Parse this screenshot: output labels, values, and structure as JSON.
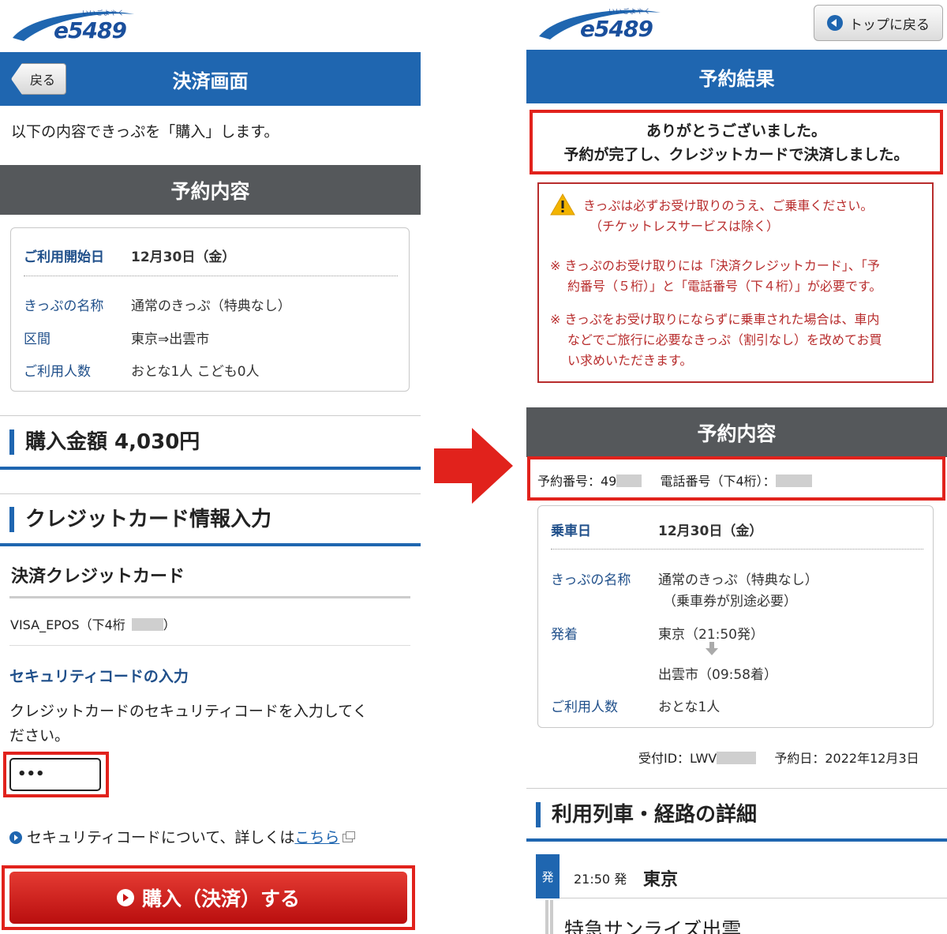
{
  "colors": {
    "primary": "#1f66b0",
    "section_gray": "#55585b",
    "accent_red": "#e1221c",
    "warning_red": "#b82d2d"
  },
  "logo": {
    "text": "e5489",
    "ruby": "いいごよやく"
  },
  "left": {
    "back_label": "戻る",
    "title": "決済画面",
    "intro": "以下の内容できっぷを「購入」します。",
    "summary_header": "予約内容",
    "summary": {
      "start_label": "ご利用開始日",
      "start_value": "12月30日（金）",
      "name_label": "きっぷの名称",
      "name_value": "通常のきっぷ（特典なし）",
      "section_label": "区間",
      "section_value": "東京⇒出雲市",
      "people_label": "ご利用人数",
      "people_value": "おとな1人 こども0人"
    },
    "price_heading": "購入金額 4,030円",
    "card_heading": "クレジットカード情報入力",
    "card_subheading": "決済クレジットカード",
    "card_value": "VISA_EPOS（下4桁",
    "card_value_end": "）",
    "security_heading": "セキュリティコードの入力",
    "security_desc_1": "クレジットカードのセキュリティコードを入力してく",
    "security_desc_2": "ださい。",
    "security_value": "•••",
    "security_link_text": "セキュリティコードについて、詳しくは",
    "security_link_label": "こちら",
    "buy_button": "購入（決済）する"
  },
  "right": {
    "top_button": "トップに戻る",
    "title": "予約結果",
    "thanks_1": "ありがとうございました。",
    "thanks_2": "予約が完了し、クレジットカードで決済しました。",
    "warn_1": "きっぷは必ずお受け取りのうえ、ご乗車ください。",
    "warn_2": "（チケットレスサービスは除く）",
    "note1_1": "※ きっぷのお受け取りには「決済クレジットカード」、「予",
    "note1_2": "約番号（５桁）」と「電話番号（下４桁）」が必要です。",
    "note2_1": "※ きっぷをお受け取りにならずに乗車された場合は、車内",
    "note2_2": "などでご旅行に必要なきっぷ（割引なし）を改めてお買",
    "note2_3": "い求めいただきます。",
    "summary_header": "予約内容",
    "reservation_no": "予約番号：49",
    "phone_no": "電話番号（下4桁）：",
    "ride_date_label": "乗車日",
    "ride_date_value": "12月30日（金）",
    "ticket_name_label": "きっぷの名称",
    "ticket_name_value": "通常のきっぷ（特典なし）",
    "ticket_name_note": "（乗車券が別途必要）",
    "dep_arr_label": "発着",
    "dep_value": "東京（21:50発）",
    "arr_value": "出雲市（09:58着）",
    "people_label": "ご利用人数",
    "people_value": "おとな1人",
    "receipt_id": "受付ID：LWV",
    "reservation_date": "予約日：2022年12月3日",
    "route_heading": "利用列車・経路の詳細",
    "dep_badge": "発",
    "dep_time": "21:50 発",
    "dep_station": "東京",
    "train_name": "特急サンライズ出雲"
  }
}
